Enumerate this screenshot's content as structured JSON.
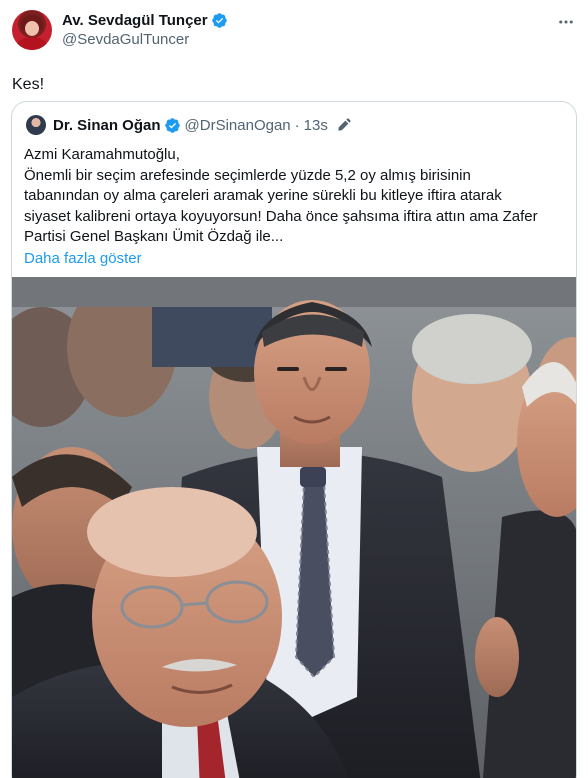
{
  "tweet": {
    "author": {
      "name": "Av. Sevdagül Tunçer",
      "handle": "@SevdaGulTuncer",
      "verified": true
    },
    "text": "Kes!",
    "more_icon": "more-options-icon"
  },
  "quoted": {
    "author": {
      "name": "Dr. Sinan Oğan",
      "handle": "@DrSinanOgan",
      "verified": true
    },
    "separator": "·",
    "time": "13s",
    "edited_icon": "pen-icon",
    "lines": [
      "Azmi Karamahmutoğlu,",
      "Önemli bir seçim arefesinde seçimlerde yüzde 5,2 oy almış birisinin",
      "tabanından oy alma çareleri aramak yerine sürekli bu kitleye iftira atarak",
      "siyaset kalibreni ortaya koyuyorsun! Daha önce şahsıma iftira attın ama Zafer",
      "Partisi Genel Başkanı Ümit Özdağ ile..."
    ],
    "show_more": "Daha fazla göster"
  },
  "colors": {
    "accent": "#1d9bf0",
    "secondary_text": "#536471",
    "border": "#cfd9de"
  }
}
